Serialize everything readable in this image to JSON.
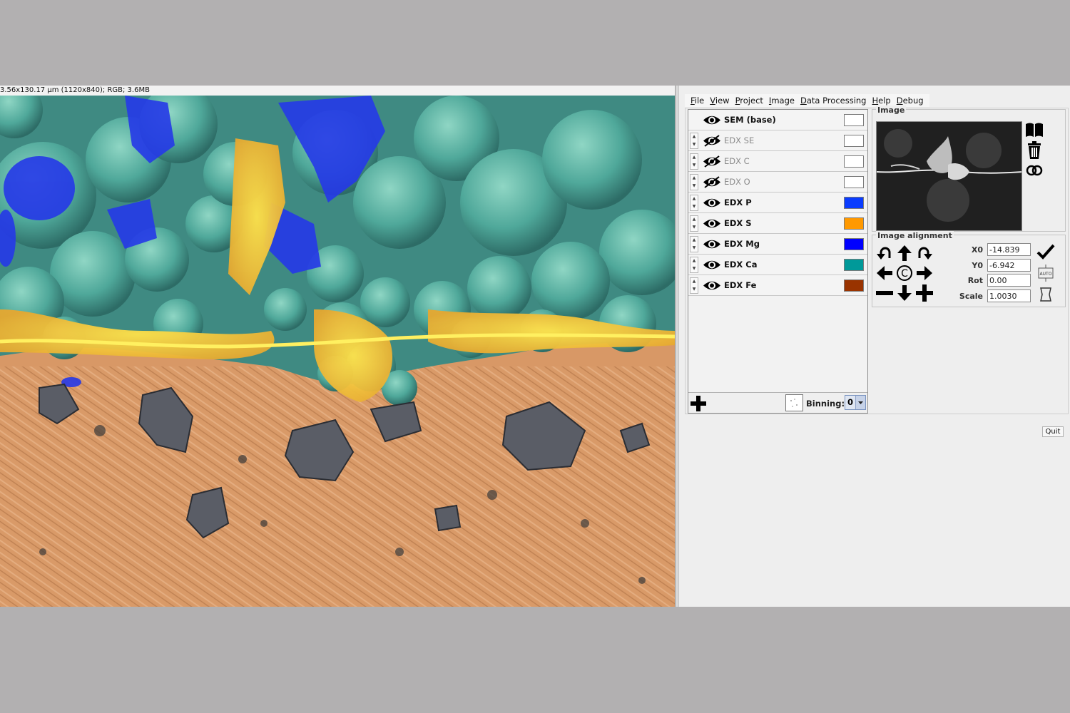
{
  "viewer": {
    "info": "3.56x130.17 µm (1120x840); RGB; 3.6MB"
  },
  "menu": [
    "File",
    "View",
    "Project",
    "Image",
    "Data Processing",
    "Help",
    "Debug"
  ],
  "layers": [
    {
      "name": "SEM (base)",
      "visible": true,
      "color": "#ffffff",
      "has_spinner": false
    },
    {
      "name": "EDX SE",
      "visible": false,
      "color": "#ffffff",
      "has_spinner": true
    },
    {
      "name": "EDX C",
      "visible": false,
      "color": "#ffffff",
      "has_spinner": true
    },
    {
      "name": "EDX O",
      "visible": false,
      "color": "#ffffff",
      "has_spinner": true
    },
    {
      "name": "EDX P",
      "visible": true,
      "color": "#0a3cff",
      "has_spinner": true
    },
    {
      "name": "EDX S",
      "visible": true,
      "color": "#ff9900",
      "has_spinner": true
    },
    {
      "name": "EDX Mg",
      "visible": true,
      "color": "#0000ff",
      "has_spinner": true
    },
    {
      "name": "EDX Ca",
      "visible": true,
      "color": "#009999",
      "has_spinner": true
    },
    {
      "name": "EDX Fe",
      "visible": true,
      "color": "#993300",
      "has_spinner": true
    }
  ],
  "footer": {
    "binning_label": "Binning:",
    "binning_value": "0"
  },
  "image_panel": {
    "title": "Image",
    "icons": [
      "book-icon",
      "trash-icon",
      "link-rings-icon"
    ]
  },
  "alignment": {
    "title": "Image alignment",
    "fields": [
      {
        "label": "X0",
        "value": "-14.839"
      },
      {
        "label": "Y0",
        "value": "-6.942"
      },
      {
        "label": "Rot",
        "value": "0.00"
      },
      {
        "label": "Scale",
        "value": "1.0030"
      }
    ],
    "icons": [
      "rotate-ccw-icon",
      "arrow-up-icon",
      "rotate-cw-icon",
      "arrow-left-icon",
      "copyright-center-icon",
      "arrow-right-icon",
      "minus-icon",
      "arrow-down-icon",
      "plus-icon",
      "checkmark-icon",
      "auto-icon",
      "shape-icon"
    ]
  },
  "quit_label": "Quit"
}
